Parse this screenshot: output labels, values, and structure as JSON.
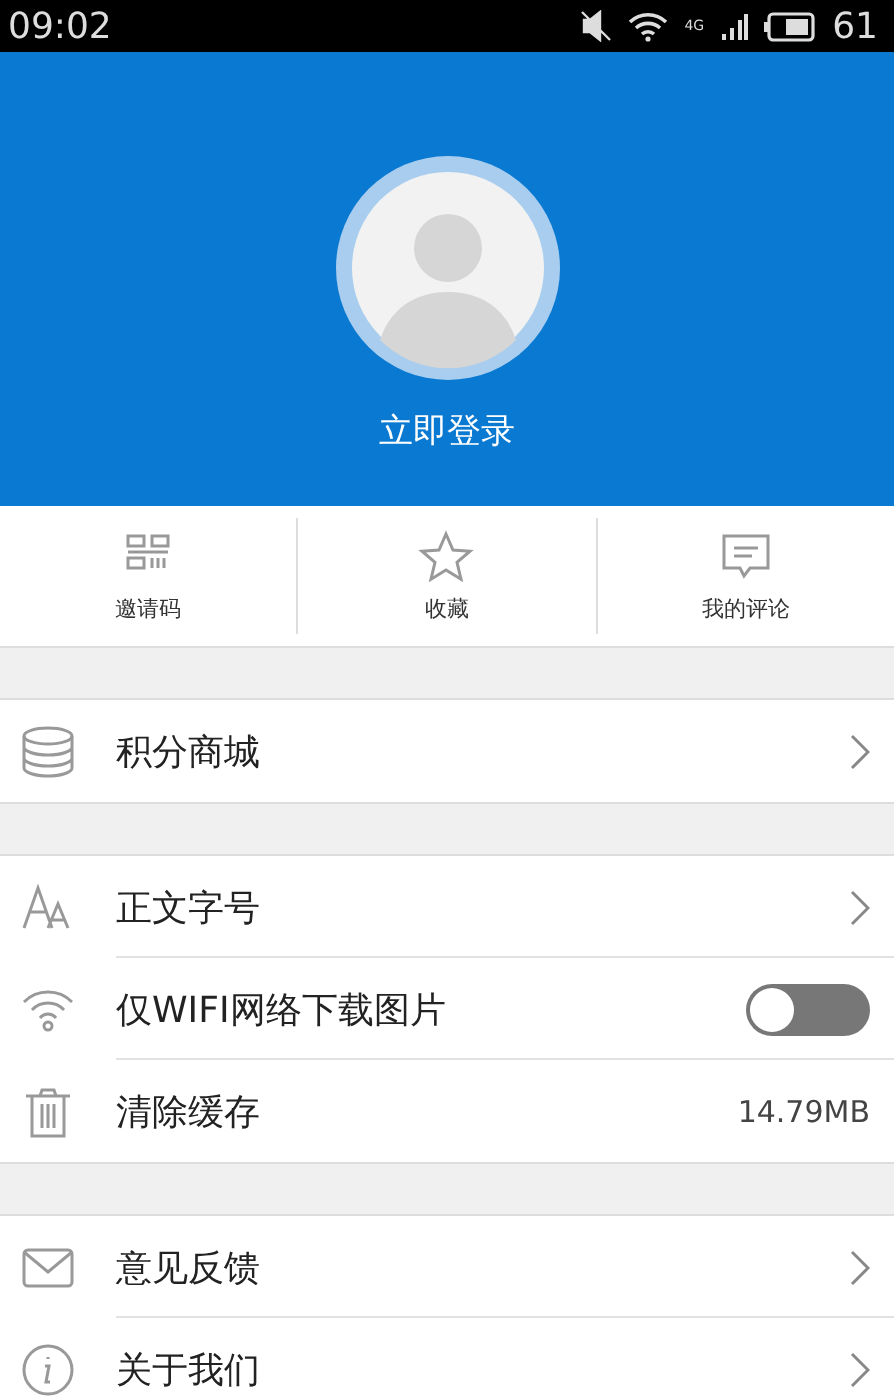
{
  "status_bar": {
    "time": "09:02",
    "network": "4G",
    "battery": "61"
  },
  "profile": {
    "login_label": "立即登录"
  },
  "quick_actions": [
    {
      "label": "邀请码"
    },
    {
      "label": "收藏"
    },
    {
      "label": "我的评论"
    }
  ],
  "sections": [
    {
      "rows": [
        {
          "kind": "link",
          "label": "积分商城"
        }
      ]
    },
    {
      "rows": [
        {
          "kind": "link",
          "label": "正文字号"
        },
        {
          "kind": "toggle",
          "label": "仅WIFI网络下载图片",
          "on": false
        },
        {
          "kind": "value",
          "label": "清除缓存",
          "value": "14.79MB"
        }
      ]
    },
    {
      "rows": [
        {
          "kind": "link",
          "label": "意见反馈"
        },
        {
          "kind": "link",
          "label": "关于我们"
        }
      ]
    }
  ]
}
